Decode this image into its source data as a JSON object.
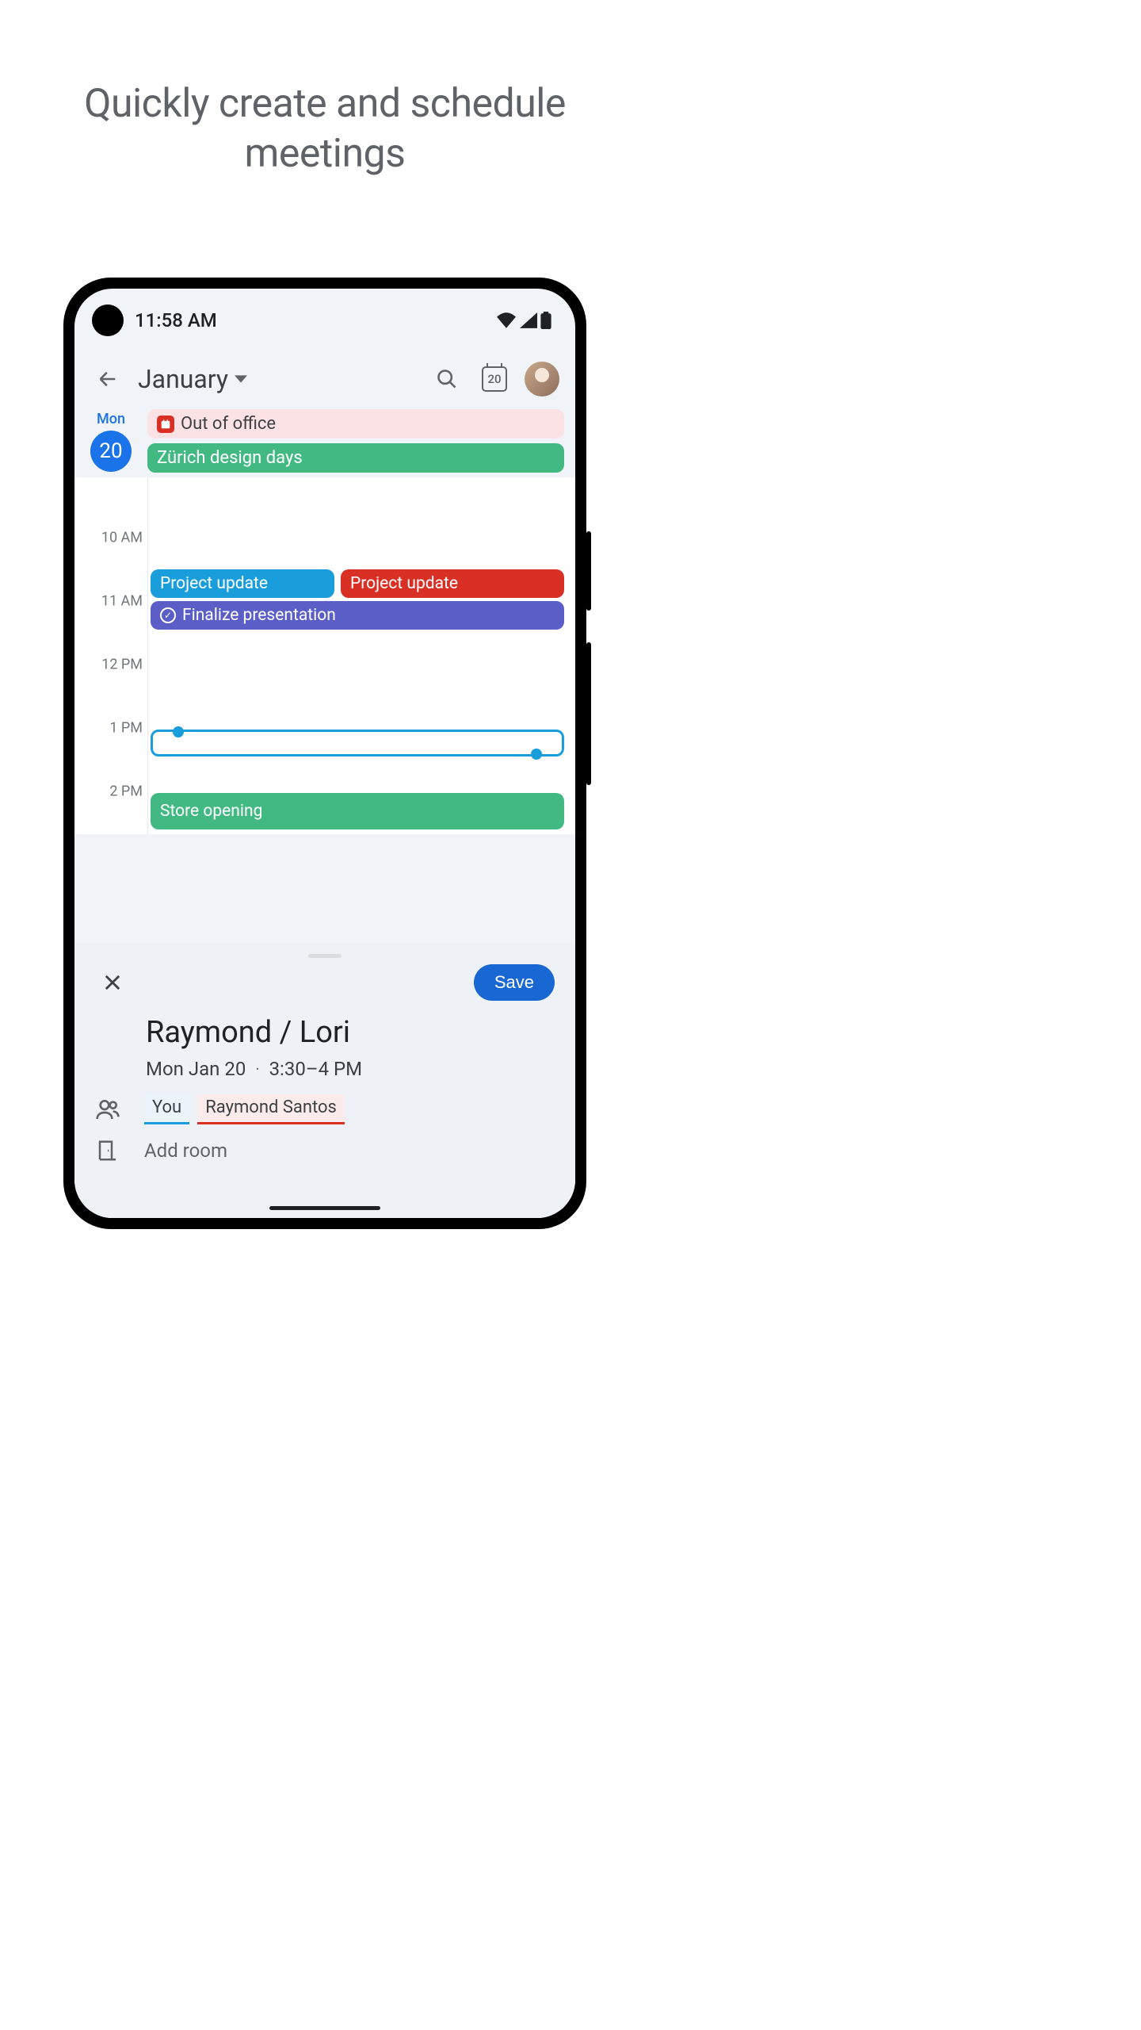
{
  "headline": "Quickly create and schedule meetings",
  "status": {
    "time": "11:58 AM"
  },
  "appbar": {
    "month": "January",
    "today_badge": "20"
  },
  "day": {
    "name": "Mon",
    "num": "20"
  },
  "allday_events": [
    {
      "label": "Out of office"
    },
    {
      "label": "Zürich design days"
    }
  ],
  "hours": [
    "10 AM",
    "11 AM",
    "12 PM",
    "1 PM",
    "2 PM"
  ],
  "timed_events": {
    "proj1": "Project update",
    "proj2": "Project update",
    "finalize": "Finalize presentation",
    "store": "Store opening"
  },
  "sheet": {
    "save": "Save",
    "title": "Raymond / Lori",
    "date": "Mon Jan 20",
    "time": "3:30–4 PM",
    "attendees": {
      "you": "You",
      "raymond": "Raymond Santos"
    },
    "add_room": "Add room"
  }
}
